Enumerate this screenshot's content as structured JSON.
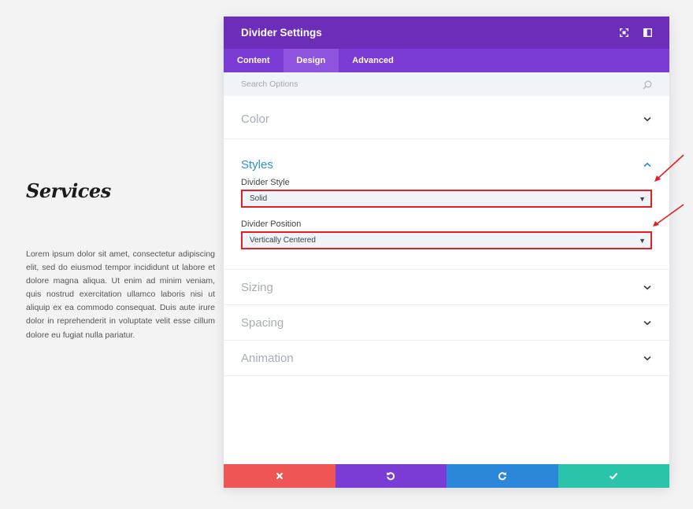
{
  "page": {
    "title": "Services",
    "body_text": "Lorem ipsum dolor sit amet, consectetur adipiscing elit, sed do eiusmod tempor incididunt ut labore et dolore magna aliqua. Ut enim ad minim veniam, quis nostrud exercitation ullamco laboris nisi ut aliquip ex ea commodo consequat. Duis aute irure dolor in reprehenderit in voluptate velit esse cillum dolore eu fugiat nulla pariatur."
  },
  "modal": {
    "title": "Divider Settings",
    "header_icons": [
      "fullscreen-icon",
      "sidebar-icon"
    ],
    "tabs": [
      {
        "label": "Content",
        "active": false
      },
      {
        "label": "Design",
        "active": true
      },
      {
        "label": "Advanced",
        "active": false
      }
    ],
    "search": {
      "placeholder": "Search Options",
      "value": ""
    },
    "sections": {
      "color": {
        "label": "Color",
        "expanded": false
      },
      "styles": {
        "label": "Styles",
        "expanded": true,
        "divider_style": {
          "label": "Divider Style",
          "value": "Solid"
        },
        "divider_position": {
          "label": "Divider Position",
          "value": "Vertically Centered"
        }
      },
      "sizing": {
        "label": "Sizing",
        "expanded": false
      },
      "spacing": {
        "label": "Spacing",
        "expanded": false
      },
      "animation": {
        "label": "Animation",
        "expanded": false
      }
    },
    "footer_buttons": [
      "close-icon",
      "undo-icon",
      "redo-icon",
      "check-icon"
    ]
  },
  "colors": {
    "header": "#6c2eb9",
    "tabs": "#7b3cd6",
    "active_section": "#2e8fd6",
    "highlight_border": "#e31f26",
    "cancel": "#ef5555",
    "undo": "#7b3cd6",
    "redo": "#2b87da",
    "save": "#29c4a9"
  }
}
